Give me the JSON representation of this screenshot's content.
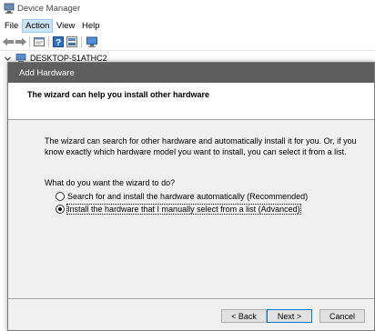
{
  "window": {
    "title": "Device Manager"
  },
  "menubar": {
    "items": [
      "File",
      "Action",
      "View",
      "Help"
    ],
    "active": "Action"
  },
  "tree": {
    "root_label": "DESKTOP-51ATHC2"
  },
  "dialog": {
    "title": "Add Hardware",
    "header": "The wizard can help you install other hardware",
    "body_line1": "The wizard can search for other hardware and automatically install it for you. Or, if you",
    "body_line2": "know exactly which hardware model you want to install, you can select it from a list.",
    "question": "What do you want the wizard to do?",
    "options": [
      {
        "label": "Search for and install the hardware automatically (Recommended)",
        "selected": false
      },
      {
        "label": "Install the hardware that I manually select from a list (Advanced)",
        "selected": true
      }
    ],
    "buttons": {
      "back": "< Back",
      "next": "Next >",
      "cancel": "Cancel"
    }
  },
  "colors": {
    "dialog_title_bar": "#5e5e5e",
    "menu_active_bg": "#cce4f7",
    "default_button_border": "#0078d7"
  }
}
